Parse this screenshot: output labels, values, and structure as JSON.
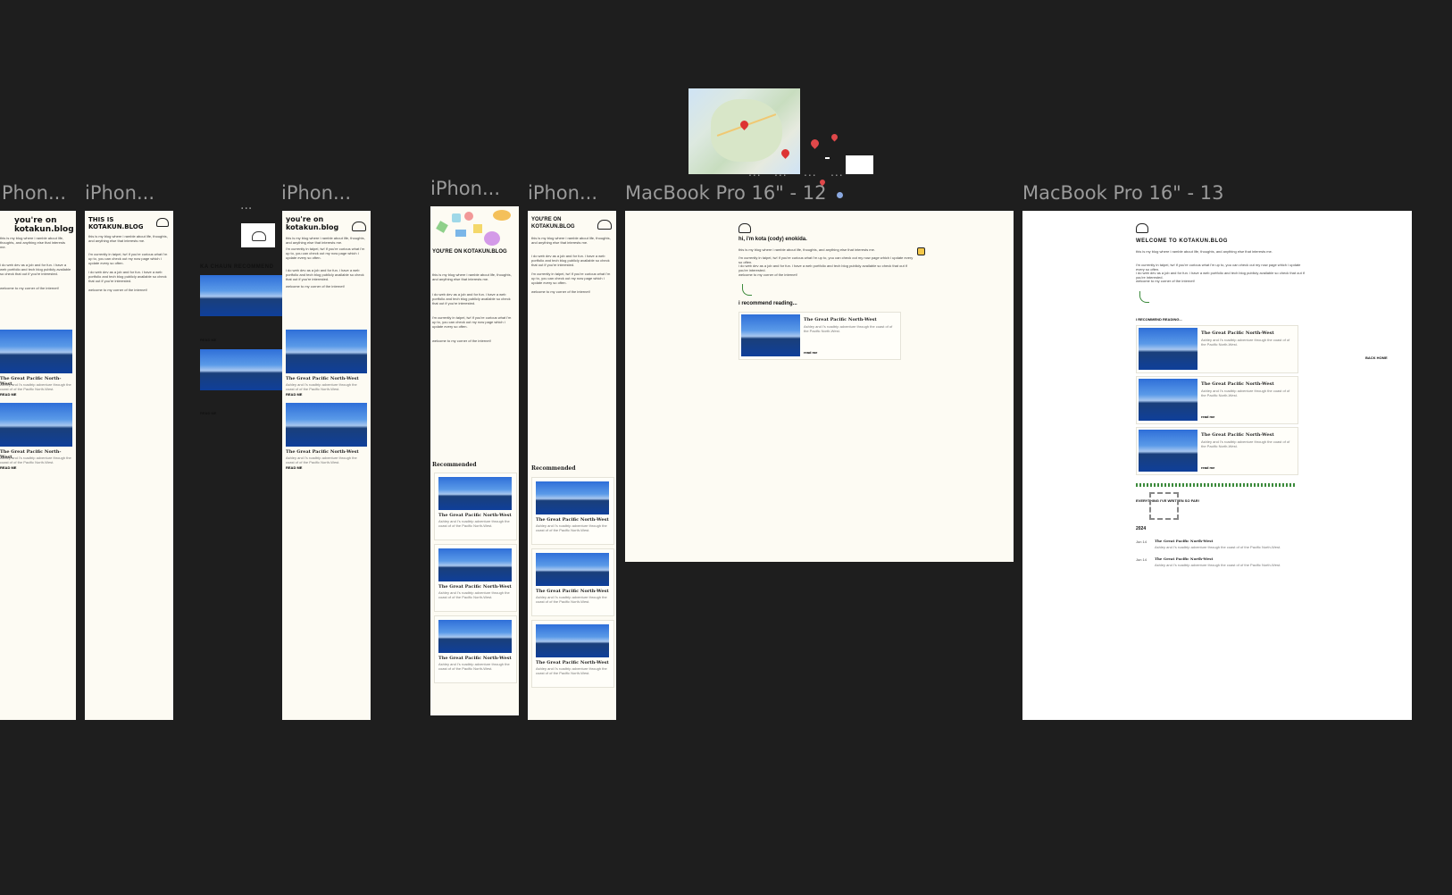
{
  "frames": [
    {
      "label": "iPhon...",
      "hero": "you're on kotakun.blog"
    },
    {
      "label": "iPhon...",
      "hero": "THIS IS KOTAKUN.BLOG"
    },
    {
      "label": "...",
      "hero": "KA CHAUN RECOMMEND"
    },
    {
      "label": "iPhon...",
      "hero": "you're on kotakun.blog"
    },
    {
      "label": "iPhon...",
      "hero": "YOU'RE ON KOTAKUN.BLOG"
    },
    {
      "label": "iPhon...",
      "hero": "YOU'RE ON KOTAKUN.BLOG"
    },
    {
      "label": "MacBook Pro 16\" - 12",
      "hero": "hi, i'm kota (cody) enokida."
    },
    {
      "label": "MacBook Pro 16\" - 13",
      "hero": "WELCOME TO KOTAKUN.BLOG"
    }
  ],
  "post": {
    "title": "The Great Pacific North-West",
    "title_caps": "The Great Pacific North-West",
    "desc": "Ashley and I's roadtrip adventure through the coast of of the Pacific North-West.",
    "read_more": "READ ME",
    "read_more_lower": "read me"
  },
  "texts": {
    "intro": "this is my blog where i ramble about life, thoughts, and anything else that interests me.",
    "work": "i do web dev as a job and for fun. i have a web portfolio and tech blog publicly available so check that out if you're interested.",
    "taipei": "i'm currently in taipei, tw! if you're curious what i'm up to, you can check out my now page which i update every so often.",
    "welcome": "welcome to my corner of the internet!",
    "recommended": "Recommended",
    "i_recommend": "i recommend reading...",
    "i_recommend_caps": "I RECOMMEND READING...",
    "everything": "EVERYTHING I'VE WRITTEN SO FAR!",
    "year": "2024",
    "date": "Jun 14",
    "back_home": "BACK HOME",
    "ellipsis": "..."
  }
}
